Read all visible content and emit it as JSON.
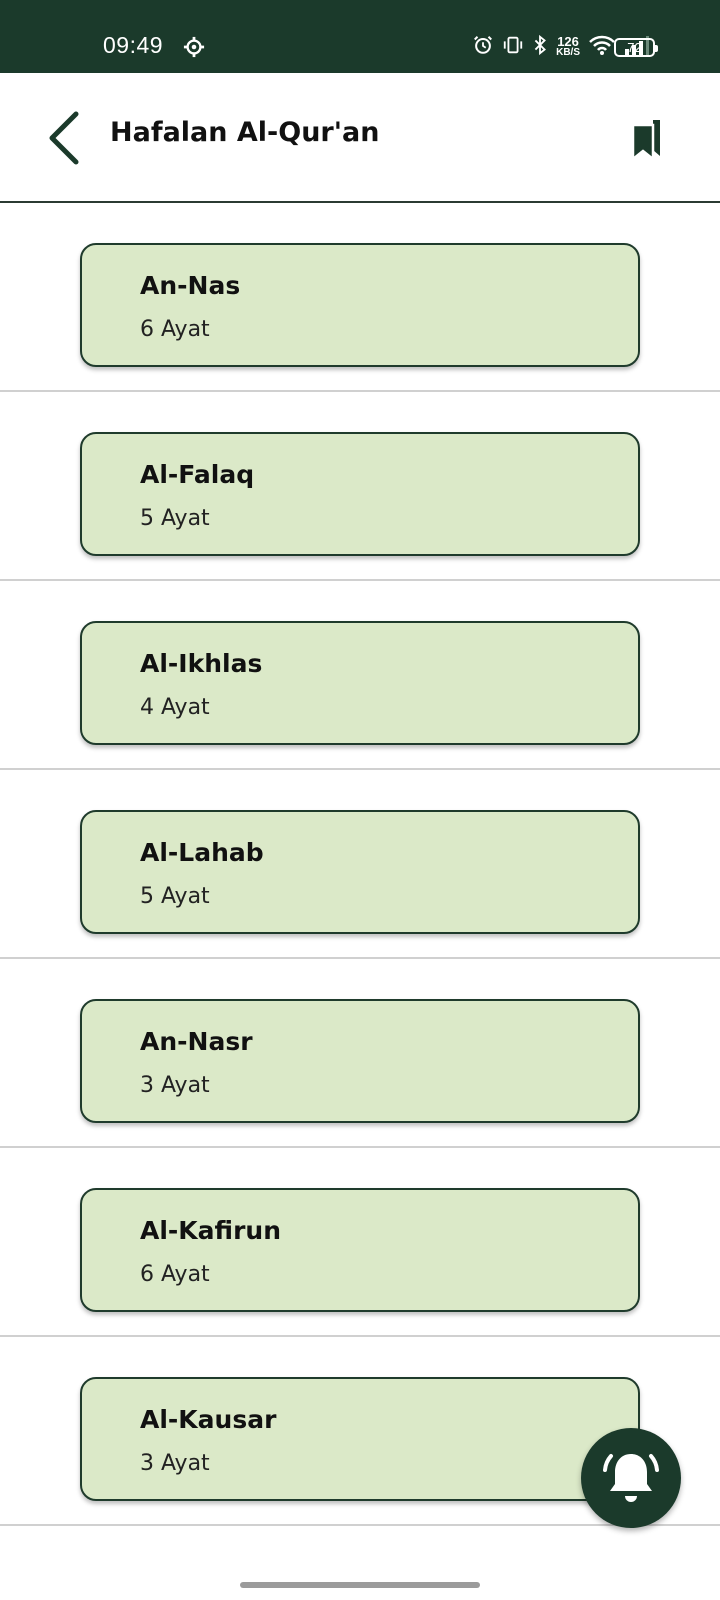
{
  "status_bar": {
    "time": "09:49",
    "net_speed_value": "126",
    "net_speed_unit": "KB/S",
    "battery": "72"
  },
  "header": {
    "title": "Hafalan Al-Qur'an",
    "back_icon": "chevron-left-icon",
    "bookmark_icon": "bookmark-icon"
  },
  "surahs": [
    {
      "name": "An-Nas",
      "count": "6 Ayat"
    },
    {
      "name": "Al-Falaq",
      "count": "5 Ayat"
    },
    {
      "name": "Al-Ikhlas",
      "count": "4 Ayat"
    },
    {
      "name": "Al-Lahab",
      "count": "5 Ayat"
    },
    {
      "name": "An-Nasr",
      "count": "3 Ayat"
    },
    {
      "name": "Al-Kafirun",
      "count": "6 Ayat"
    },
    {
      "name": "Al-Kausar",
      "count": "3 Ayat"
    }
  ],
  "fab": {
    "icon": "bell-icon"
  },
  "colors": {
    "primary": "#1b3a2b",
    "card_bg": "#dbe9c8",
    "divider": "#d0d0d0"
  }
}
